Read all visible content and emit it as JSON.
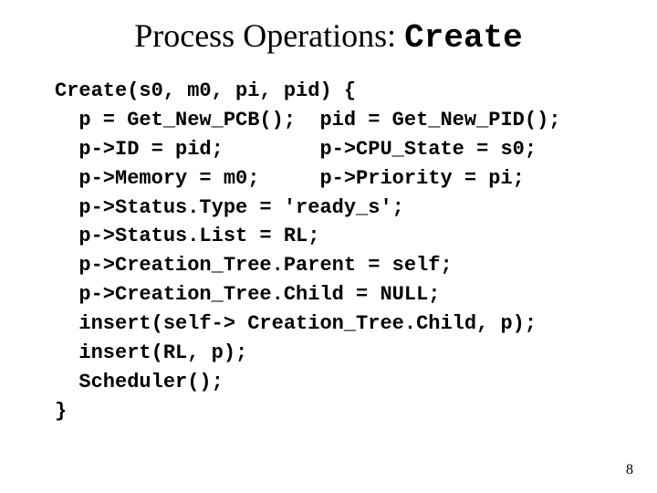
{
  "title": {
    "prefix": "Process Operations: ",
    "mono": "Create"
  },
  "code": {
    "l1": "Create(s0, m0, pi, pid) {",
    "l2": "  p = Get_New_PCB();  pid = Get_New_PID();",
    "l3": "  p->ID = pid;        p->CPU_State = s0;",
    "l4": "  p->Memory = m0;     p->Priority = pi;",
    "l5": "  p->Status.Type = 'ready_s';",
    "l6": "  p->Status.List = RL;",
    "l7": "  p->Creation_Tree.Parent = self;",
    "l8": "  p->Creation_Tree.Child = NULL;",
    "l9": "  insert(self-> Creation_Tree.Child, p);",
    "l10": "  insert(RL, p);",
    "l11": "  Scheduler();",
    "l12": "}"
  },
  "page_number": "8"
}
